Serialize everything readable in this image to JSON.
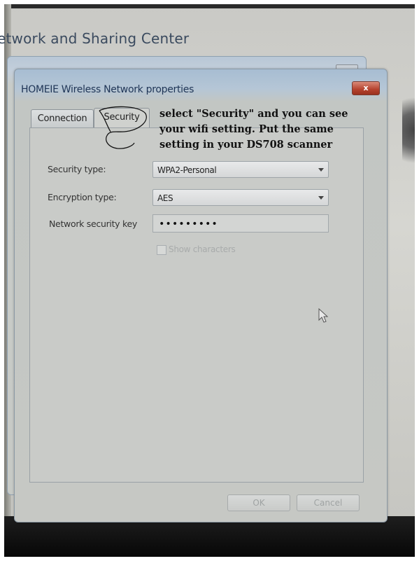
{
  "background_window": {
    "title": "etwork and Sharing Center"
  },
  "dialog": {
    "title": "HOMEIE Wireless Network properties",
    "close_label": "x",
    "tabs": [
      {
        "label": "Connection",
        "active": false
      },
      {
        "label": "Security",
        "active": true
      }
    ],
    "security_type": {
      "label": "Security type:",
      "value": "WPA2-Personal"
    },
    "encryption_type": {
      "label": "Encryption type:",
      "value": "AES"
    },
    "network_key": {
      "label": "Network security key",
      "value": "•••••••••"
    },
    "show_characters": {
      "label": "Show characters",
      "checked": false
    },
    "buttons": {
      "ok": "OK",
      "cancel": "Cancel"
    }
  },
  "annotation": {
    "lines": [
      "select \"Security\" and you can see",
      "your wifi setting. Put the same",
      "setting in your DS708 scanner"
    ]
  },
  "colors": {
    "title_bar": "#a7bdd2",
    "close_button": "#b5412d",
    "dialog_body": "#c6c8c4"
  }
}
